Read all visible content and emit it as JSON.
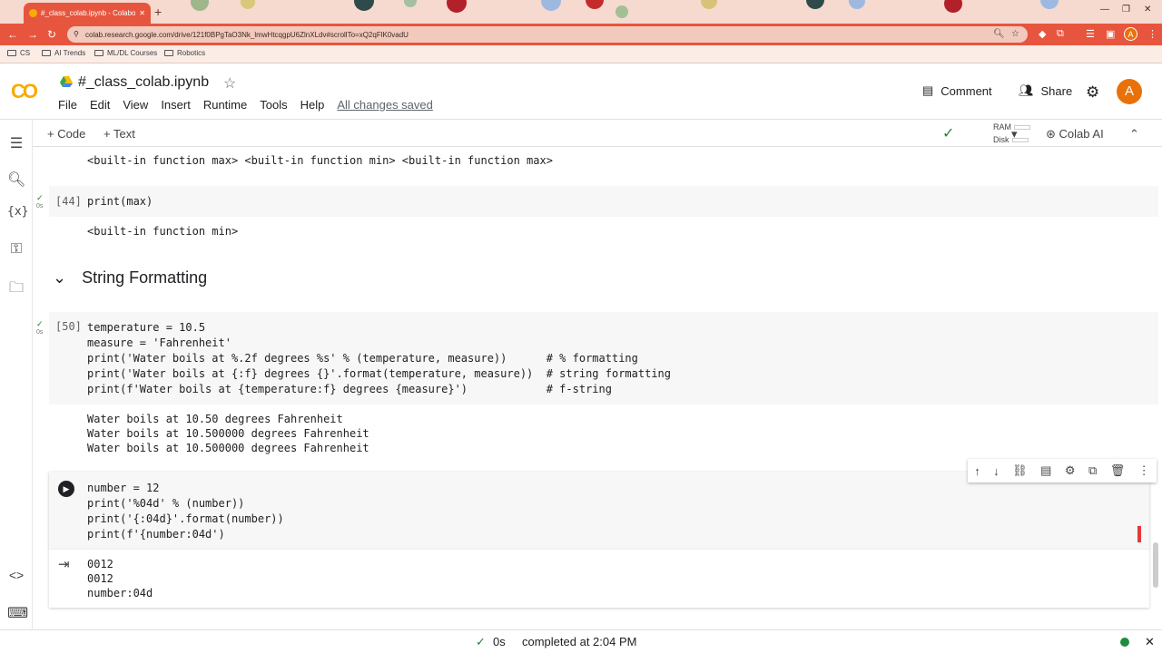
{
  "browser": {
    "tab_title": "#_class_colab.ipynb - Colabora",
    "url": "colab.research.google.com/drive/121f0BPgTaO3Nk_lmwHtcqgpU6ZlnXLdv#scrollTo=xQ2qFlK0vadU",
    "bookmarks": [
      "CS",
      "AI Trends",
      "ML/DL Courses",
      "Robotics"
    ],
    "avatar_letter": "A"
  },
  "header": {
    "logo": "CO",
    "notebook_title": "#_class_colab.ipynb",
    "menu": [
      "File",
      "Edit",
      "View",
      "Insert",
      "Runtime",
      "Tools",
      "Help"
    ],
    "saved_status": "All changes saved",
    "comment_label": "Comment",
    "share_label": "Share",
    "avatar_letter": "A"
  },
  "toolbar": {
    "code_label": "Code",
    "text_label": "Text",
    "ram_label": "RAM",
    "disk_label": "Disk",
    "colab_ai_label": "Colab AI"
  },
  "cells": {
    "prev_output": "<built-in function max> <built-in function min> <built-in function max>",
    "cell44": {
      "exec": "[44]",
      "time": "0s",
      "code": "print(max)",
      "output": "<built-in function min>"
    },
    "section_title": "String Formatting",
    "cell50": {
      "exec": "[50]",
      "time": "0s",
      "code": [
        "temperature = 10.5",
        "measure = 'Fahrenheit'",
        "print('Water boils at %.2f degrees %s' % (temperature, measure))      # % formatting",
        "print('Water boils at {:f} degrees {}'.format(temperature, measure))  # string formatting",
        "print(f'Water boils at {temperature:f} degrees {measure}')            # f-string"
      ],
      "output": [
        "Water boils at 10.50 degrees Fahrenheit",
        "Water boils at 10.500000 degrees Fahrenheit",
        "Water boils at 10.500000 degrees Fahrenheit"
      ]
    },
    "cell_active": {
      "code": [
        "number = 12",
        "print('%04d' % (number))",
        "print('{:04d}'.format(number))",
        "print(f'{number:04d')"
      ],
      "output": [
        "0012",
        "0012",
        "number:04d"
      ]
    }
  },
  "status": {
    "time": "0s",
    "completed": "completed at 2:04 PM"
  }
}
